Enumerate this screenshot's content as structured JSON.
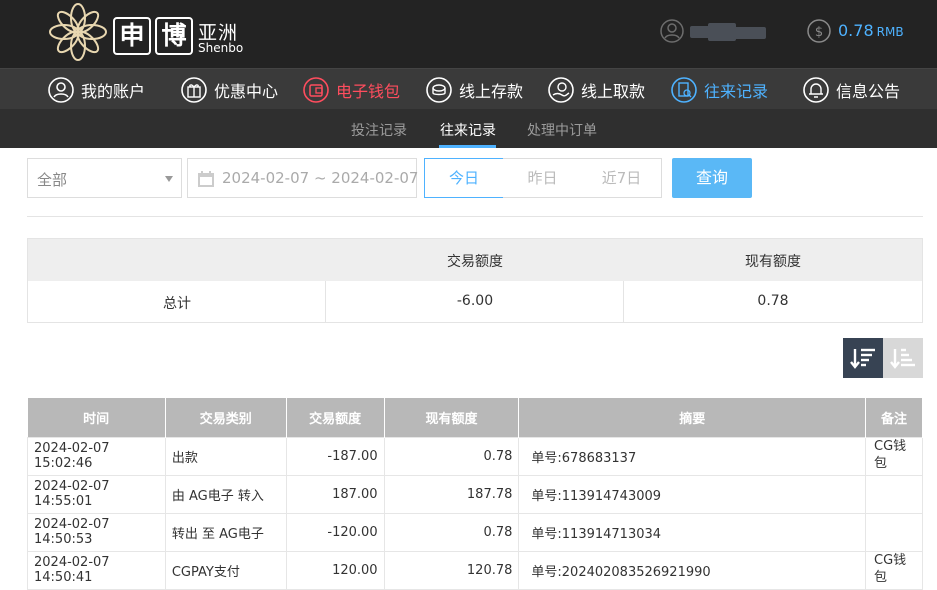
{
  "header": {
    "logo_char1": "申",
    "logo_char2": "博",
    "logo_cn": "亚洲",
    "logo_en": "Shenbo",
    "balance_value": "0.78",
    "balance_unit": "RMB"
  },
  "nav": [
    {
      "label": "我的账户",
      "icon": "user-icon"
    },
    {
      "label": "优惠中心",
      "icon": "gift-icon"
    },
    {
      "label": "电子钱包",
      "icon": "wallet-icon"
    },
    {
      "label": "线上存款",
      "icon": "deposit-icon"
    },
    {
      "label": "线上取款",
      "icon": "withdraw-icon"
    },
    {
      "label": "往来记录",
      "icon": "records-icon"
    },
    {
      "label": "信息公告",
      "icon": "bell-icon"
    }
  ],
  "subnav": [
    {
      "label": "投注记录"
    },
    {
      "label": "往来记录"
    },
    {
      "label": "处理中订单"
    }
  ],
  "filters": {
    "select_value": "全部",
    "date_range": "2024-02-07 ~ 2024-02-07",
    "quick": [
      "今日",
      "昨日",
      "近7日"
    ],
    "search_label": "查询"
  },
  "summary": {
    "col_amount": "交易额度",
    "col_balance": "现有额度",
    "row_label": "总计",
    "amount": "-6.00",
    "balance": "0.78"
  },
  "table": {
    "headers": [
      "时间",
      "交易类别",
      "交易额度",
      "现有额度",
      "摘要",
      "备注"
    ],
    "rows": [
      {
        "time": "2024-02-07 15:02:46",
        "type": "出款",
        "amount": "-187.00",
        "balance": "0.78",
        "summary": "单号:678683137",
        "note": "CG钱包"
      },
      {
        "time": "2024-02-07 14:55:01",
        "type": "由 AG电子 转入",
        "amount": "187.00",
        "balance": "187.78",
        "summary": "单号:113914743009",
        "note": ""
      },
      {
        "time": "2024-02-07 14:50:53",
        "type": "转出 至 AG电子",
        "amount": "-120.00",
        "balance": "0.78",
        "summary": "单号:113914713034",
        "note": ""
      },
      {
        "time": "2024-02-07 14:50:41",
        "type": "CGPAY支付",
        "amount": "120.00",
        "balance": "120.78",
        "summary": "单号:202402083526921990",
        "note": "CG钱包"
      }
    ]
  },
  "colors": {
    "accent_blue": "#4eb2ff",
    "accent_red": "#ff4d5e",
    "header_bg": "#232323",
    "nav_bg": "#3a3a3a"
  }
}
